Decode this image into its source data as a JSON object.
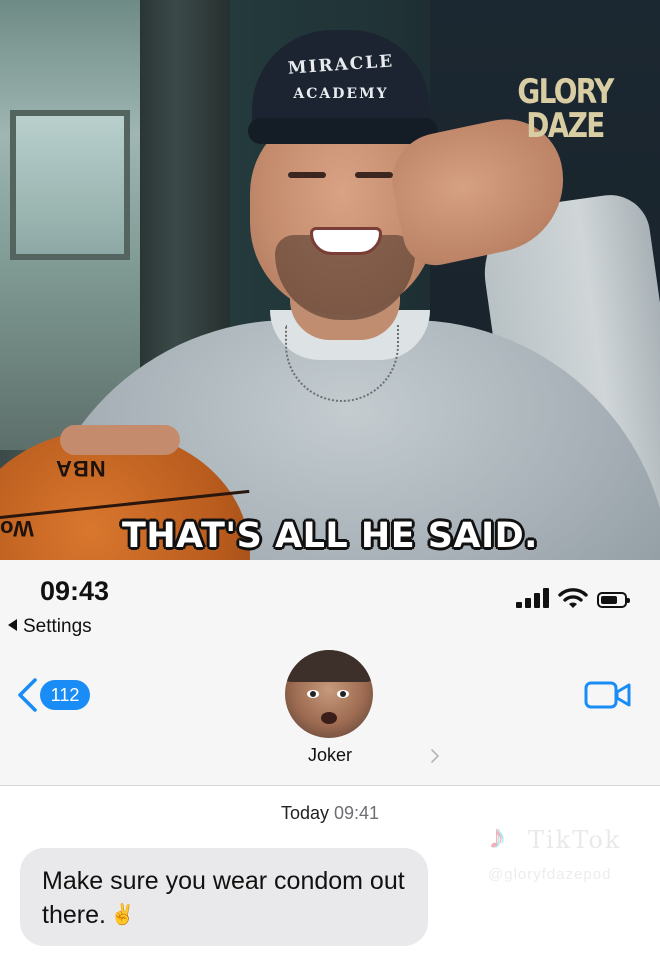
{
  "video": {
    "cap_line1": "MIRACLE",
    "cap_line2": "ACADEMY",
    "brand_line1": "GLORY",
    "brand_line2": "DAZE",
    "ball_logo": "NBA",
    "ball_text": "Wo",
    "caption": "THAT'S ALL HE SAID."
  },
  "status_bar": {
    "time": "09:43",
    "back_label": "Settings"
  },
  "conversation": {
    "unread_count": "112",
    "contact_name": "Joker",
    "timestamp_day": "Today",
    "timestamp_time": "09:41",
    "messages": [
      {
        "direction": "incoming",
        "text": "Make sure you wear condom out there.",
        "emoji": "✌"
      }
    ]
  },
  "watermark": {
    "word": "TikTok",
    "handle": "@gloryfdazepod"
  },
  "colors": {
    "imessage_blue": "#1a8cf5",
    "bubble_gray": "#e9e9eb",
    "status_bg": "#f6f6f6"
  },
  "icons": {
    "back": "chevron-left-icon",
    "video_call": "video-camera-icon",
    "signal": "cellular-signal-icon",
    "wifi": "wifi-icon",
    "battery": "battery-icon"
  }
}
